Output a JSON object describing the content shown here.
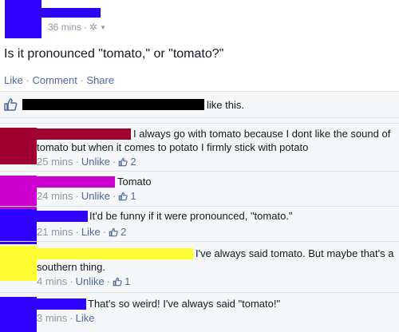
{
  "post": {
    "time": "36 mins",
    "question": "Is it pronounced \"tomato,\" or \"tomato?\"",
    "actions": {
      "like": "Like",
      "comment": "Comment",
      "share": "Share",
      "sep": "·"
    },
    "likes_suffix": "like this."
  },
  "comments": [
    {
      "color": "#a0002f",
      "text1": "I always go with tomato because I dont like the sound of",
      "text2": "tomato but when it comes to potato I firmly stick with potato",
      "time": "25 mins",
      "action": "Unlike",
      "count": "2"
    },
    {
      "color": "#cc00cc",
      "text1": "Tomato",
      "time": "24 mins",
      "action": "Unlike",
      "count": "1"
    },
    {
      "color": "#2e00ff",
      "text1": "It'd be funny if it were pronounced, \"tomato.\"",
      "time": "21 mins",
      "action": "Like",
      "count": "2"
    },
    {
      "color": "#ffff33",
      "text1": "I've always said tomato. But maybe that's a",
      "text2": "southern thing.",
      "time": "4 mins",
      "action": "Unlike",
      "count": "1"
    },
    {
      "color": "#2e00ff",
      "text1": "That's so weird! I've always said \"tomato!\"",
      "time": "3 mins",
      "action": "Like"
    }
  ],
  "icons": {
    "gear": "gear-icon",
    "caret": "caret-down-icon",
    "thumb": "thumbs-up-icon"
  }
}
